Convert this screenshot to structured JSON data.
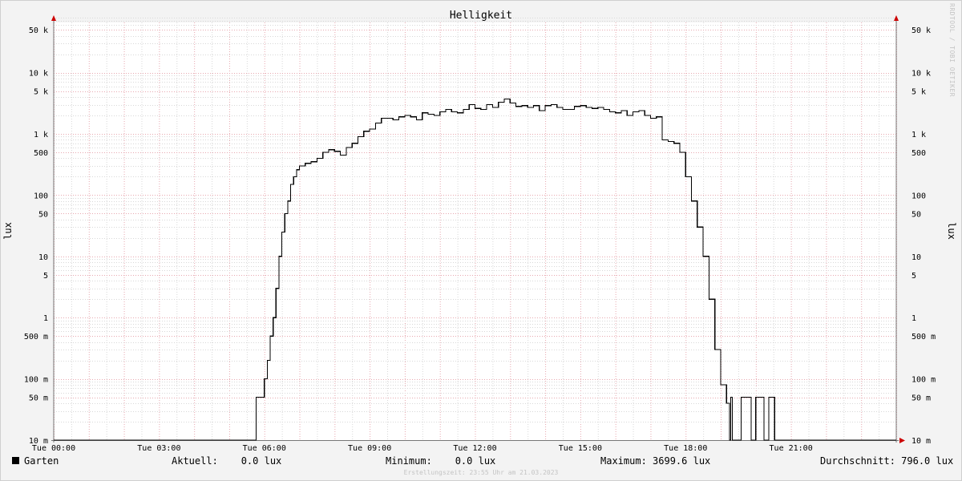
{
  "chart_data": {
    "type": "line",
    "title": "Helligkeit",
    "ylabel": "lux",
    "y_scale": "log",
    "ylim": [
      0.01,
      80000
    ],
    "x_range": [
      "00:00",
      "24:00"
    ],
    "x_ticks": [
      "Tue 00:00",
      "Tue 03:00",
      "Tue 06:00",
      "Tue 09:00",
      "Tue 12:00",
      "Tue 15:00",
      "Tue 18:00",
      "Tue 21:00"
    ],
    "y_ticks": [
      "10 m",
      "50 m",
      "100 m",
      "500 m",
      "1",
      "5",
      "10",
      "50",
      "100",
      "500",
      "1 k",
      "5 k",
      "10 k",
      "50 k"
    ],
    "grid": true,
    "series": [
      {
        "name": "Garten",
        "color": "#000000",
        "points": [
          [
            "00:00",
            0.01
          ],
          [
            "05:45",
            0.01
          ],
          [
            "05:46",
            0.05
          ],
          [
            "05:55",
            0.05
          ],
          [
            "06:00",
            0.1
          ],
          [
            "06:05",
            0.2
          ],
          [
            "06:10",
            0.5
          ],
          [
            "06:15",
            1
          ],
          [
            "06:20",
            3
          ],
          [
            "06:25",
            10
          ],
          [
            "06:30",
            25
          ],
          [
            "06:35",
            50
          ],
          [
            "06:40",
            80
          ],
          [
            "06:45",
            150
          ],
          [
            "06:50",
            200
          ],
          [
            "06:55",
            260
          ],
          [
            "07:00",
            300
          ],
          [
            "07:10",
            330
          ],
          [
            "07:20",
            350
          ],
          [
            "07:30",
            400
          ],
          [
            "07:40",
            500
          ],
          [
            "07:50",
            550
          ],
          [
            "08:00",
            520
          ],
          [
            "08:10",
            450
          ],
          [
            "08:20",
            600
          ],
          [
            "08:30",
            700
          ],
          [
            "08:40",
            900
          ],
          [
            "08:50",
            1100
          ],
          [
            "09:00",
            1200
          ],
          [
            "09:10",
            1500
          ],
          [
            "09:20",
            1800
          ],
          [
            "09:30",
            1800
          ],
          [
            "09:40",
            1700
          ],
          [
            "09:50",
            1900
          ],
          [
            "10:00",
            2000
          ],
          [
            "10:10",
            1900
          ],
          [
            "10:20",
            1700
          ],
          [
            "10:30",
            2200
          ],
          [
            "10:40",
            2100
          ],
          [
            "10:50",
            2000
          ],
          [
            "11:00",
            2300
          ],
          [
            "11:10",
            2500
          ],
          [
            "11:20",
            2300
          ],
          [
            "11:30",
            2200
          ],
          [
            "11:40",
            2500
          ],
          [
            "11:50",
            3000
          ],
          [
            "12:00",
            2600
          ],
          [
            "12:10",
            2500
          ],
          [
            "12:20",
            3000
          ],
          [
            "12:30",
            2700
          ],
          [
            "12:40",
            3300
          ],
          [
            "12:50",
            3700
          ],
          [
            "13:00",
            3200
          ],
          [
            "13:10",
            2800
          ],
          [
            "13:20",
            2900
          ],
          [
            "13:30",
            2700
          ],
          [
            "13:40",
            2900
          ],
          [
            "13:50",
            2400
          ],
          [
            "14:00",
            2900
          ],
          [
            "14:10",
            3000
          ],
          [
            "14:20",
            2700
          ],
          [
            "14:30",
            2500
          ],
          [
            "14:40",
            2500
          ],
          [
            "14:50",
            2800
          ],
          [
            "15:00",
            2900
          ],
          [
            "15:10",
            2700
          ],
          [
            "15:20",
            2600
          ],
          [
            "15:30",
            2700
          ],
          [
            "15:40",
            2500
          ],
          [
            "15:50",
            2300
          ],
          [
            "16:00",
            2200
          ],
          [
            "16:10",
            2400
          ],
          [
            "16:20",
            2000
          ],
          [
            "16:30",
            2300
          ],
          [
            "16:40",
            2400
          ],
          [
            "16:50",
            2000
          ],
          [
            "17:00",
            1800
          ],
          [
            "17:10",
            1900
          ],
          [
            "17:20",
            800
          ],
          [
            "17:30",
            750
          ],
          [
            "17:40",
            700
          ],
          [
            "17:50",
            500
          ],
          [
            "18:00",
            200
          ],
          [
            "18:10",
            80
          ],
          [
            "18:20",
            30
          ],
          [
            "18:30",
            10
          ],
          [
            "18:40",
            2
          ],
          [
            "18:50",
            0.3
          ],
          [
            "19:00",
            0.08
          ],
          [
            "19:10",
            0.04
          ],
          [
            "19:15",
            0.01
          ],
          [
            "19:17",
            0.05
          ],
          [
            "19:20",
            0.01
          ],
          [
            "19:30",
            0.01
          ],
          [
            "19:35",
            0.05
          ],
          [
            "19:50",
            0.05
          ],
          [
            "19:52",
            0.01
          ],
          [
            "19:58",
            0.01
          ],
          [
            "20:00",
            0.05
          ],
          [
            "20:12",
            0.05
          ],
          [
            "20:14",
            0.01
          ],
          [
            "20:20",
            0.01
          ],
          [
            "20:22",
            0.05
          ],
          [
            "20:30",
            0.05
          ],
          [
            "20:32",
            0.01
          ],
          [
            "24:00",
            0.01
          ]
        ]
      }
    ]
  },
  "legend": {
    "series_name": "Garten",
    "current": "Aktuell:    0.0 lux",
    "minimum": "Minimum:    0.0 lux",
    "maximum": "Maximum: 3699.6 lux",
    "average": "Durchschnitt: 796.0 lux"
  },
  "footer": "Erstellungszeit: 23:55 Uhr am 21.03.2023",
  "watermark": "RRDTOOL / TOBI OETIKER",
  "colors": {
    "background": "#f3f3f3",
    "plot": "#ffffff",
    "major_grid": "#e8a8b0",
    "minor_grid": "#d8d8d8",
    "axis_arrow": "#cc0000"
  }
}
